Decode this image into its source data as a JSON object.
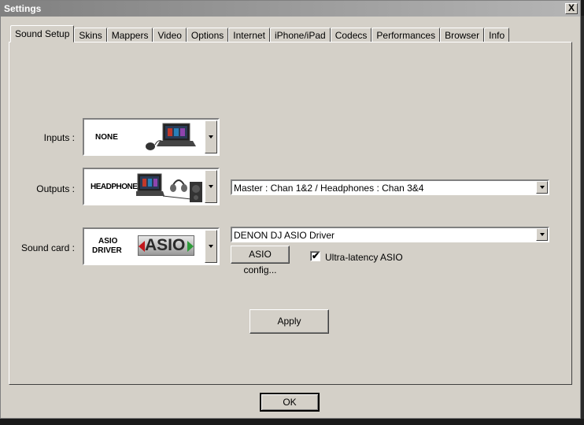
{
  "window": {
    "title": "Settings",
    "close_label": "X"
  },
  "tabs": [
    {
      "label": "Sound Setup",
      "active": true
    },
    {
      "label": "Skins"
    },
    {
      "label": "Mappers"
    },
    {
      "label": "Video"
    },
    {
      "label": "Options"
    },
    {
      "label": "Internet"
    },
    {
      "label": "iPhone/iPad"
    },
    {
      "label": "Codecs"
    },
    {
      "label": "Performances"
    },
    {
      "label": "Browser"
    },
    {
      "label": "Info"
    }
  ],
  "inputs": {
    "label": "Inputs :",
    "value": "NONE",
    "picture": "laptop-with-mouse"
  },
  "outputs": {
    "label": "Outputs :",
    "value": "HEADPHONES",
    "picture": "laptop-headphones-speaker",
    "channel_mapping": "Master : Chan 1&2 / Headphones : Chan 3&4"
  },
  "soundcard": {
    "label": "Sound card :",
    "value_line1": "ASIO",
    "value_line2": "DRIVER",
    "logo_text": "ASIO",
    "driver": "DENON DJ ASIO Driver",
    "config_button": "ASIO config...",
    "ultra_latency_label": "Ultra-latency ASIO",
    "ultra_latency_checked": true,
    "check_mark": "✔"
  },
  "apply_button": "Apply",
  "ok_button": "OK",
  "colors": {
    "face": "#d4d0c8",
    "title_gradient_start": "#808080",
    "asio_logo_red": "#c0161b",
    "asio_logo_green": "#2e9b3a"
  }
}
